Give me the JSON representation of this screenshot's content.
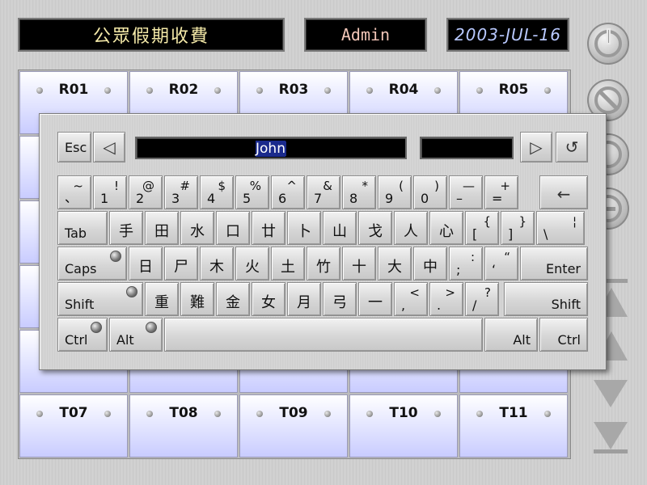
{
  "header": {
    "title": "公眾假期收費",
    "user": "Admin",
    "date": "2003-JUL-16"
  },
  "grid": {
    "top_row": [
      "R01",
      "R02",
      "R03",
      "R04",
      "R05"
    ],
    "bottom_row": [
      "T07",
      "T08",
      "T09",
      "T10",
      "T11"
    ]
  },
  "keyboard": {
    "esc_label": "Esc",
    "input_value": "John",
    "backspace_glyph": "◁",
    "next_glyph": "▷",
    "undo_glyph": "↺",
    "row1": [
      {
        "up": "~",
        "lo": "、"
      },
      {
        "up": "!",
        "lo": "1"
      },
      {
        "up": "@",
        "lo": "2"
      },
      {
        "up": "#",
        "lo": "3"
      },
      {
        "up": "$",
        "lo": "4"
      },
      {
        "up": "%",
        "lo": "5"
      },
      {
        "up": "^",
        "lo": "6"
      },
      {
        "up": "&",
        "lo": "7"
      },
      {
        "up": "*",
        "lo": "8"
      },
      {
        "up": "(",
        "lo": "9"
      },
      {
        "up": ")",
        "lo": "0"
      },
      {
        "up": "—",
        "lo": "–"
      },
      {
        "up": "+",
        "lo": "="
      }
    ],
    "backspace_row_glyph": "←",
    "tab_label": "Tab",
    "row2": [
      "手",
      "田",
      "水",
      "口",
      "廿",
      "卜",
      "山",
      "戈",
      "人",
      "心"
    ],
    "row2_punct": [
      {
        "up": "{",
        "lo": "["
      },
      {
        "up": "}",
        "lo": "]"
      },
      {
        "up": "¦",
        "lo": "\\"
      }
    ],
    "caps_label": "Caps",
    "row3": [
      "日",
      "尸",
      "木",
      "火",
      "土",
      "竹",
      "十",
      "大",
      "中"
    ],
    "row3_punct": [
      {
        "up": ":",
        "lo": ";"
      },
      {
        "up": "“",
        "lo": "‘"
      }
    ],
    "enter_label": "Enter",
    "shift_label": "Shift",
    "row4": [
      "重",
      "難",
      "金",
      "女",
      "月",
      "弓",
      "一"
    ],
    "row4_punct": [
      {
        "up": "<",
        "lo": ","
      },
      {
        "up": ">",
        "lo": "."
      },
      {
        "up": "?",
        "lo": "/"
      }
    ],
    "ctrl_label": "Ctrl",
    "alt_label": "Alt"
  }
}
